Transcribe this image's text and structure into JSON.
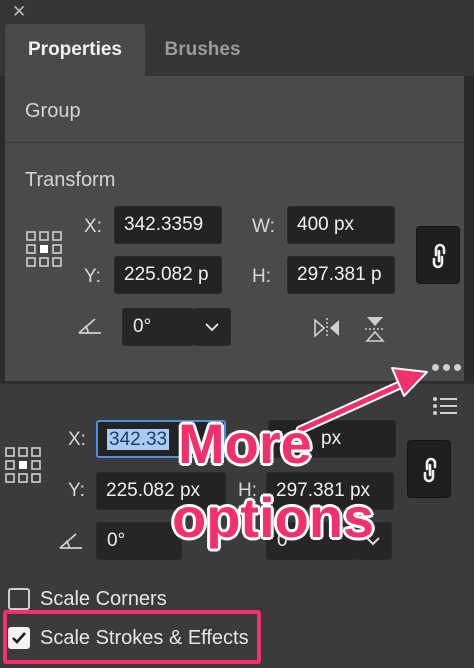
{
  "window": {
    "close_glyph": "✕"
  },
  "tabs": [
    {
      "label": "Properties",
      "active": true
    },
    {
      "label": "Brushes",
      "active": false
    }
  ],
  "selection": {
    "type_label": "Group"
  },
  "transform": {
    "title": "Transform",
    "x_label": "X:",
    "x_value": "342.3359",
    "y_label": "Y:",
    "y_value": "225.082 p",
    "w_label": "W:",
    "w_value": "400 px",
    "h_label": "H:",
    "h_value": "297.381 p",
    "angle_value": "0°"
  },
  "more_options": {
    "icon": "ellipsis-icon"
  },
  "zoomed_transform": {
    "x_label": "X:",
    "x_value": "342.33",
    "y_label": "Y:",
    "y_value": "225.082 px",
    "w_value": "px",
    "h_label": "H:",
    "h_value": "297.381 px",
    "angle_value": "0°",
    "angle_value_right": "0°"
  },
  "options": {
    "scale_corners_label": "Scale Corners",
    "scale_corners_checked": false,
    "scale_strokes_label": "Scale Strokes & Effects",
    "scale_strokes_checked": true
  },
  "annotation": {
    "line1": "More",
    "line2": "options",
    "color": "#f2306b"
  }
}
